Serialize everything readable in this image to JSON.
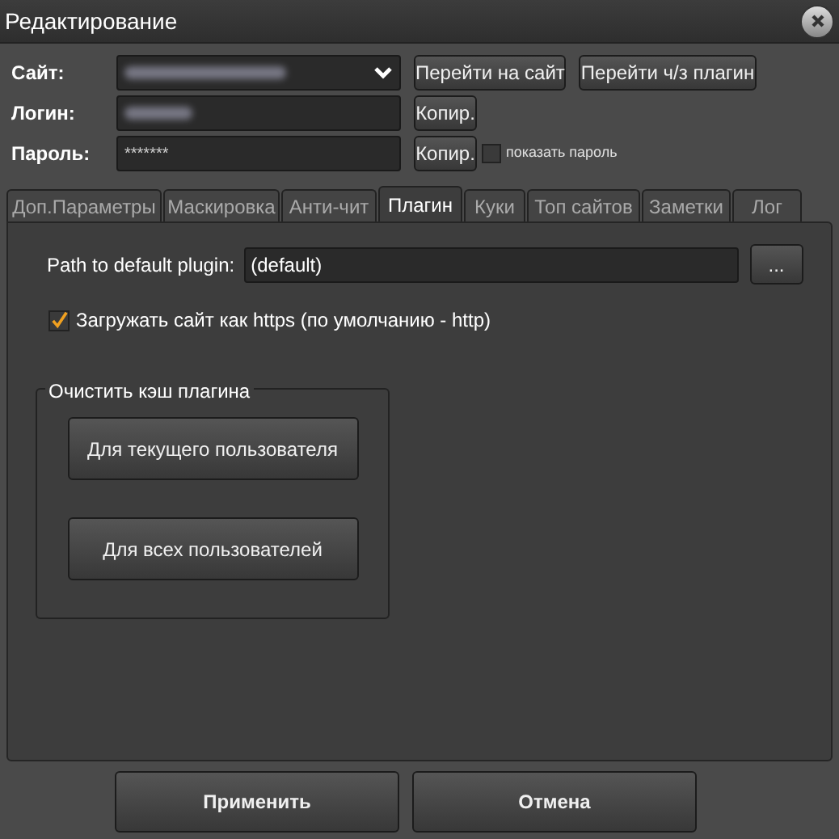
{
  "window": {
    "title": "Редактирование"
  },
  "site": {
    "label": "Сайт:",
    "value_blurred": true
  },
  "site_buttons": [
    "Перейти на сайт",
    "Перейти ч/з плагин"
  ],
  "login": {
    "label": "Логин:",
    "value_blurred": true,
    "copy_button": "Копир."
  },
  "password": {
    "label": "Пароль:",
    "value": "*******",
    "copy_button": "Копир.",
    "show_password": {
      "label": "показать пароль",
      "checked": false
    }
  },
  "tabs": [
    {
      "label": "Доп.Параметры",
      "selected": false
    },
    {
      "label": "Маскировка",
      "selected": false
    },
    {
      "label": "Анти-чит",
      "selected": false
    },
    {
      "label": "Плагин",
      "selected": true
    },
    {
      "label": "Куки",
      "selected": false
    },
    {
      "label": "Топ сайтов",
      "selected": false
    },
    {
      "label": "Заметки",
      "selected": false
    },
    {
      "label": "Лог",
      "selected": false
    }
  ],
  "plugin_path": {
    "label": "Path to default plugin:",
    "value": "(default)",
    "browse_button": "..."
  },
  "https_checkbox": {
    "label": "Загружать сайт как https (по умолчанию - http)",
    "checked": true
  },
  "clear_cache": {
    "title": "Очистить кэш плагина",
    "buttons": [
      "Для текущего пользователя",
      "Для всех пользователей"
    ]
  },
  "footer_buttons": [
    "Применить",
    "Отмена"
  ]
}
